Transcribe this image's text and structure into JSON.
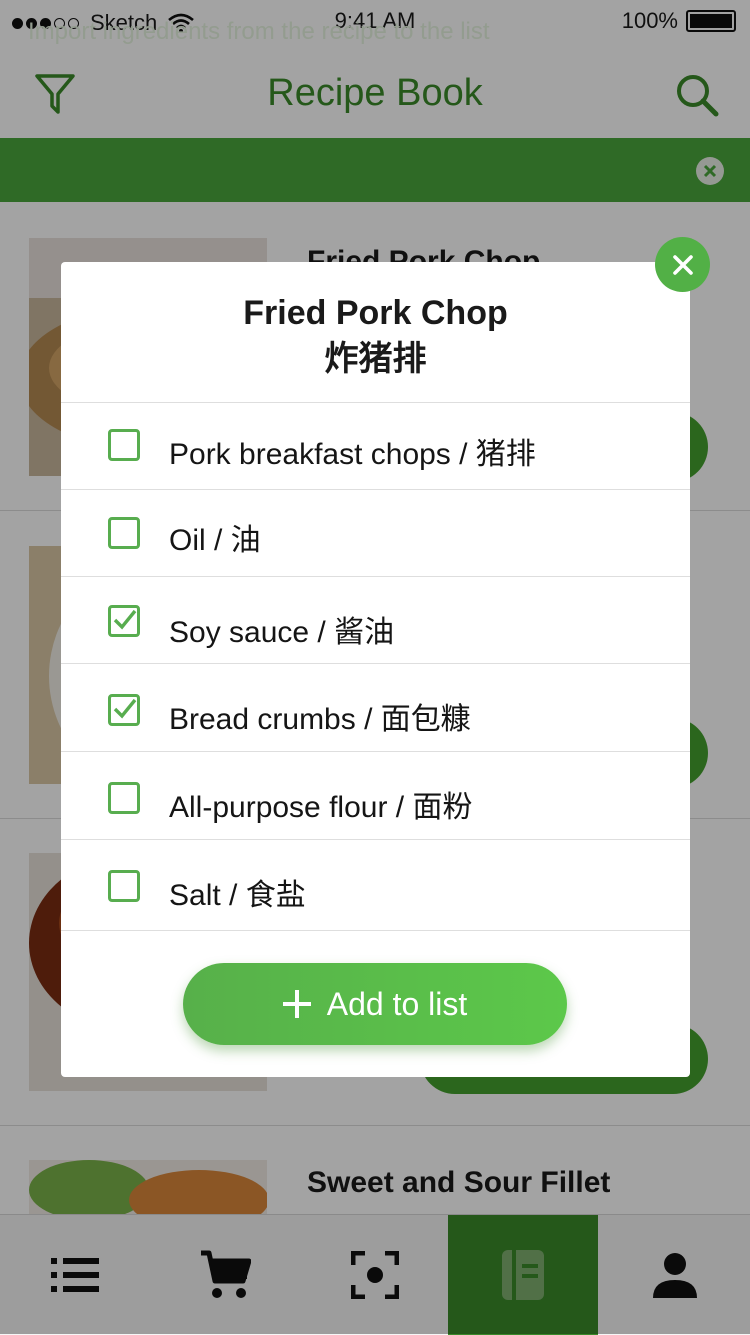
{
  "status_bar": {
    "carrier": "Sketch",
    "time": "9:41 AM",
    "battery": "100%"
  },
  "header": {
    "title": "Recipe Book"
  },
  "banner": {
    "text": "Import ingredients from the recipe to the list"
  },
  "recipes": [
    {
      "title": "Fried Pork Chop"
    },
    {
      "title": ""
    },
    {
      "title": ""
    },
    {
      "title": "Sweet and Sour Fillet"
    }
  ],
  "modal": {
    "title_en": "Fried Pork Chop",
    "title_zh": "炸猪排",
    "ingredients": [
      {
        "label": "Pork breakfast chops / 猪排",
        "checked": false
      },
      {
        "label": "Oil / 油",
        "checked": false
      },
      {
        "label": "Soy sauce / 酱油",
        "checked": true
      },
      {
        "label": "Bread crumbs / 面包糠",
        "checked": true
      },
      {
        "label": "All-purpose flour / 面粉",
        "checked": false
      },
      {
        "label": "Salt / 食盐",
        "checked": false
      }
    ],
    "add_button_label": "Add to list"
  },
  "tabs": [
    {
      "icon": "list-icon",
      "active": false
    },
    {
      "icon": "cart-icon",
      "active": false
    },
    {
      "icon": "scan-icon",
      "active": false
    },
    {
      "icon": "recipe-book-icon",
      "active": true
    },
    {
      "icon": "profile-icon",
      "active": false
    }
  ],
  "colors": {
    "accent": "#3a8a2a",
    "banner": "#4aa63c",
    "button": "#5cc84a"
  }
}
